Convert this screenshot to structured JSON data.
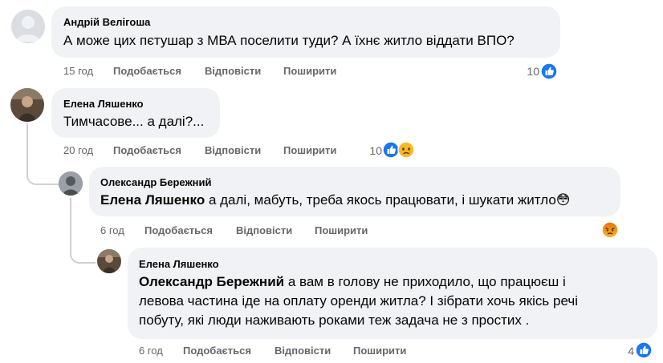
{
  "comments": [
    {
      "author": "Андрій Велігоша",
      "text": "А може цих пєтушар з МВА поселити туди? А їхнє житло віддати ВПО?",
      "time": "15 год",
      "reaction_count": "10"
    },
    {
      "author": "Елена Ляшенко",
      "text": "Тимчасове... а далі?...",
      "time": "20 год",
      "reaction_count": "10"
    },
    {
      "author": "Олександр Бережний",
      "mention": "Елена Ляшенко",
      "text": " а далі, мабуть, треба якось працювати, і шукати житло😳",
      "time": "6 год"
    },
    {
      "author": "Елена Ляшенко",
      "mention": "Олександр Бережний",
      "text_line1": " а вам в голову не приходило, що працюєш і",
      "text_line2": "левова частина іде на оплату оренди житла? І зібрати хочь якісь речі",
      "text_line3": "побуту, які люди наживають роками теж задача не з простих .",
      "time": "6 год",
      "reaction_count": "4"
    }
  ],
  "actions": {
    "like": "Подобається",
    "reply": "Відповісти",
    "share": "Поширити"
  },
  "icons": {
    "like": "like-icon",
    "sad": "sad-reaction-icon",
    "angry": "angry-reaction-icon",
    "avatar_default": "default-avatar-icon"
  },
  "colors": {
    "like_blue": "#1877f2",
    "bubble": "#f0f2f5",
    "meta_gray": "#65676b"
  }
}
